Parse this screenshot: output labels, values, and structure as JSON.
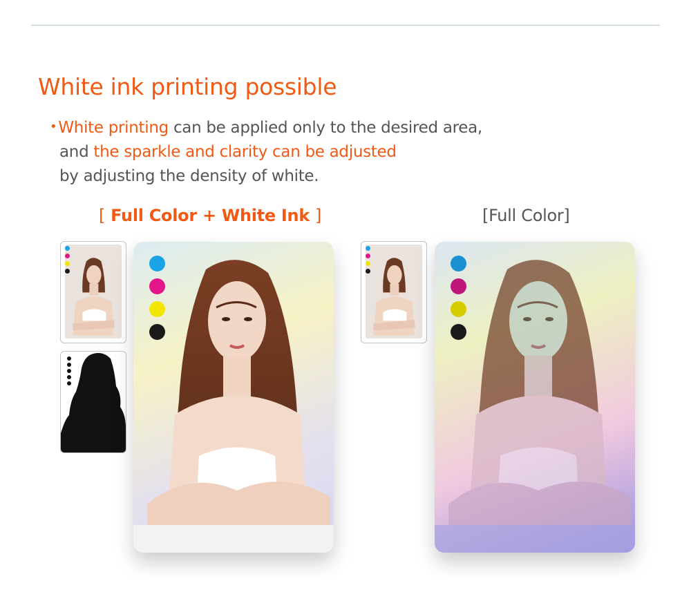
{
  "title": "White ink printing possible",
  "description": {
    "line1": {
      "highlight": "White printing",
      "rest": " can be applied only to the desired area,"
    },
    "line2": {
      "prefix": "and ",
      "highlight": "the sparkle and clarity can be adjusted"
    },
    "line3": "by adjusting the density of white."
  },
  "bullet": "•",
  "left": {
    "label_open": "[",
    "label": "Full Color + White Ink",
    "label_close": "]"
  },
  "right": {
    "label_open": "[",
    "label": "Full Color",
    "label_close": "]"
  },
  "ink_colors": {
    "cyan": "#1ba3e8",
    "magenta": "#e4158a",
    "yellow": "#f2e500",
    "black": "#1a1a1a",
    "cyan_dim": "#1a8fd1",
    "magenta_dim": "#c0157a",
    "yellow_dim": "#d6cc00"
  },
  "accent_color": "#f05a14",
  "text_color": "#555555"
}
